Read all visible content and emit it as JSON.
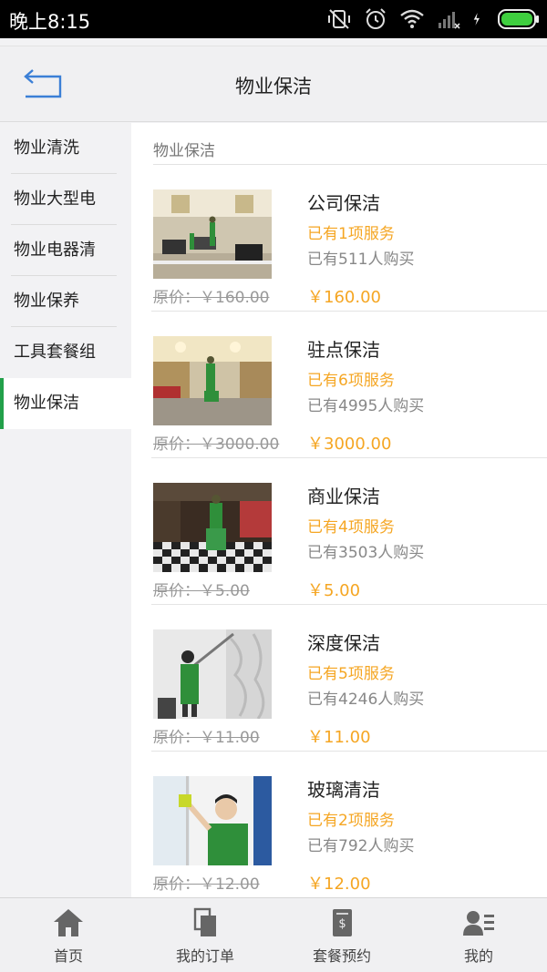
{
  "status_bar": {
    "time": "晚上8:15",
    "icons": [
      "mute-vibrate-icon",
      "alarm-icon",
      "wifi-icon",
      "signal-icon",
      "charging-icon",
      "battery-icon"
    ]
  },
  "header": {
    "title": "物业保洁",
    "back_icon": "back-arrow-icon",
    "accent": "#3b7fd6"
  },
  "sidebar": {
    "items": [
      {
        "label": "物业清洗",
        "active": false
      },
      {
        "label": "物业大型电",
        "active": false
      },
      {
        "label": "物业电器清",
        "active": false
      },
      {
        "label": "物业保养",
        "active": false
      },
      {
        "label": "工具套餐组",
        "active": false
      },
      {
        "label": "物业保洁",
        "active": true
      }
    ],
    "active_color": "#22a04a"
  },
  "content": {
    "section_title": "物业保洁",
    "products": [
      {
        "name": "公司保洁",
        "services": "已有1项服务",
        "buyers": "已有511人购买",
        "original_price": "原价：￥160.00",
        "price": "￥160.00"
      },
      {
        "name": "驻点保洁",
        "services": "已有6项服务",
        "buyers": "已有4995人购买",
        "original_price": "原价：￥3000.00",
        "price": "￥3000.00"
      },
      {
        "name": "商业保洁",
        "services": "已有4项服务",
        "buyers": "已有3503人购买",
        "original_price": "原价：￥5.00",
        "price": "￥5.00"
      },
      {
        "name": "深度保洁",
        "services": "已有5项服务",
        "buyers": "已有4246人购买",
        "original_price": "原价：￥11.00",
        "price": "￥11.00"
      },
      {
        "name": "玻璃清洁",
        "services": "已有2项服务",
        "buyers": "已有792人购买",
        "original_price": "原价：￥12.00",
        "price": "￥12.00"
      }
    ],
    "price_color": "#f5a623"
  },
  "tabbar": {
    "tabs": [
      {
        "label": "首页",
        "icon": "home-icon"
      },
      {
        "label": "我的订单",
        "icon": "orders-icon"
      },
      {
        "label": "套餐预约",
        "icon": "booking-icon"
      },
      {
        "label": "我的",
        "icon": "profile-icon"
      }
    ]
  }
}
